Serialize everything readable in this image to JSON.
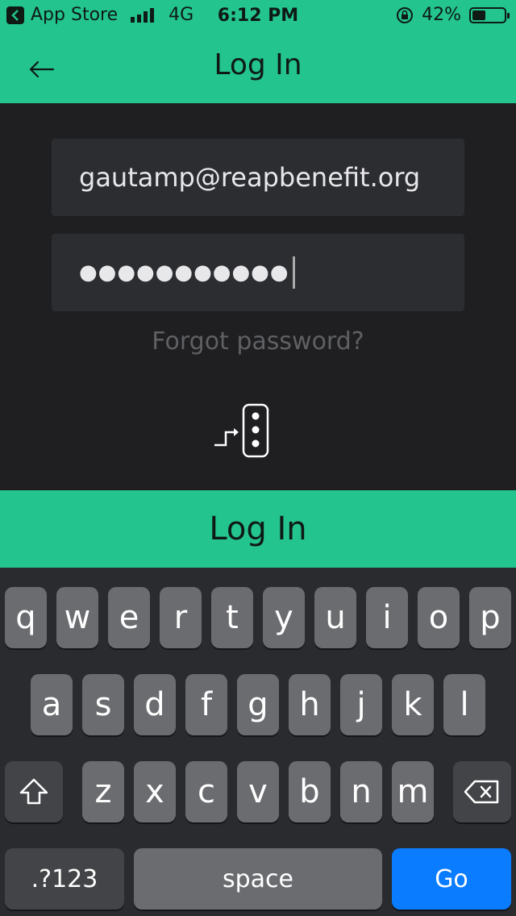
{
  "status_bar": {
    "back_app": "App Store",
    "network": "4G",
    "time": "6:12 PM",
    "battery_percent": "42%",
    "battery_level": 0.42
  },
  "header": {
    "title": "Log In",
    "back_icon": "arrow-left-icon"
  },
  "form": {
    "email_value": "gautamp@reapbenefit.org",
    "password_masked": "●●●●●●●●●●●",
    "forgot_password": "Forgot password?"
  },
  "login_button": "Log In",
  "keyboard": {
    "row1": [
      "q",
      "w",
      "e",
      "r",
      "t",
      "y",
      "u",
      "i",
      "o",
      "p"
    ],
    "row2": [
      "a",
      "s",
      "d",
      "f",
      "g",
      "h",
      "j",
      "k",
      "l"
    ],
    "row3": [
      "z",
      "x",
      "c",
      "v",
      "b",
      "n",
      "m"
    ],
    "numbers_label": ".?123",
    "space_label": "space",
    "go_label": "Go",
    "shift_icon": "shift-icon",
    "delete_icon": "backspace-icon"
  },
  "colors": {
    "accent": "#23c48e",
    "background": "#1f1f22",
    "go_key": "#0a7cff"
  }
}
